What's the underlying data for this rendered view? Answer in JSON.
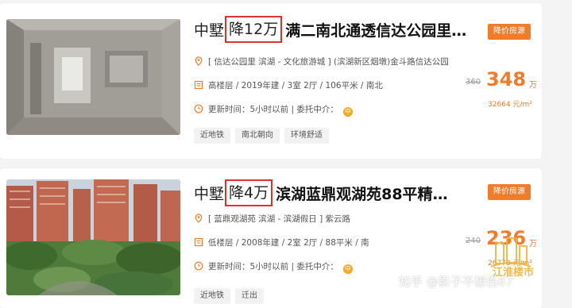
{
  "listings": [
    {
      "title_prefix": "中墅",
      "title_drop": "降12万",
      "title_main": "满二南北通透信达公园里...",
      "badge": "降价房源",
      "location": "[ 信达公园里 滨湖 - 文化旅游城 ] (滨湖新区烟墩)金斗路信达公园",
      "details": "高楼层 / 2019年建 / 3室 2厅 / 106平米 / 南北",
      "update": "更新时间：5小时以前 | 委托中介：",
      "old_price": "360",
      "price": "348",
      "price_unit": "万",
      "unit_price": "32664 元/m²",
      "tags": [
        "近地铁",
        "南北朝向",
        "环境舒适"
      ]
    },
    {
      "title_prefix": "中墅",
      "title_drop": "降4万",
      "title_main": "滨湖蓝鼎观湖苑88平精装...",
      "badge": "降价房源",
      "location": "[ 蓝鼎观湖苑 滨湖 - 滨湖假日 ] 紫云路",
      "details": "低楼层 / 2008年建 / 2室 2厅 / 88平米 / 南",
      "update": "更新时间：5小时以前 | 委托中介：",
      "old_price": "240",
      "price": "236",
      "price_unit": "万",
      "unit_price": "26770 元/m²",
      "tags": [
        "近地铁",
        "迁出"
      ]
    }
  ],
  "agent_badge": "中",
  "watermark": {
    "city": "江淮楼市",
    "zhihu": "知乎 @影子不想伤67"
  },
  "colors": {
    "accent": "#f07c2a",
    "highlight_border": "#d9332b",
    "tag_bg": "#f2f2f2"
  },
  "icons": [
    "location-pin-icon",
    "house-details-icon",
    "clock-icon"
  ]
}
